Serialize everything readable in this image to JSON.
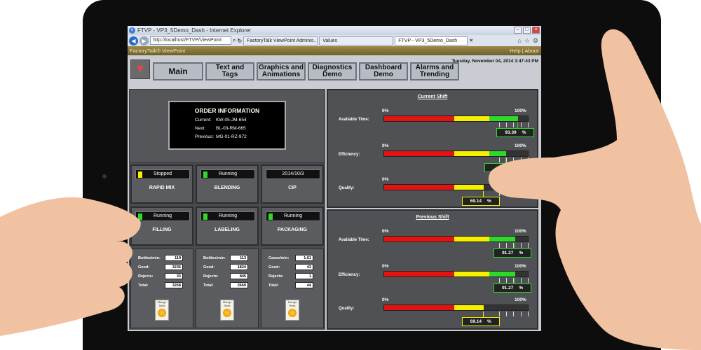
{
  "browser": {
    "window_title": "FTVP - VP3_5Demo_Dash - Internet Explorer",
    "url": "http://localhost/FTVP/ViewPoint",
    "tabs": [
      {
        "label": "FactoryTalk ViewPoint Adminis..."
      },
      {
        "label": "Values"
      },
      {
        "label": "FTVP - VP3_5Demo_Dash"
      }
    ]
  },
  "viewpoint_bar": {
    "brand": "FactoryTalk® ViewPoint",
    "help": "Help",
    "separator": "|",
    "about": "About"
  },
  "header": {
    "datetime": "Tuesday, November 04, 2014 3:47:43 PM",
    "nav": [
      {
        "line1": "Main",
        "line2": ""
      },
      {
        "line1": "Text and",
        "line2": "Tags"
      },
      {
        "line1": "Graphics and",
        "line2": "Animations"
      },
      {
        "line1": "Diagnostics",
        "line2": "Demo"
      },
      {
        "line1": "Dashboard",
        "line2": "Demo"
      },
      {
        "line1": "Alarms and",
        "line2": "Trending"
      }
    ]
  },
  "order": {
    "title": "ORDER INFORMATION",
    "current_label": "Current:",
    "current": "KW-05-JM-654",
    "next_label": "Next:",
    "next": "BL-03-RM-665",
    "previous_label": "Previous:",
    "previous": "MG-01-RZ-972"
  },
  "units": [
    {
      "name": "RAPID MIX",
      "status": "Stopped",
      "indicator_color": "#f4f000"
    },
    {
      "name": "BLENDING",
      "status": "Running",
      "indicator_color": "#2fd92b"
    },
    {
      "name": "CIP",
      "status": "2014/10/3",
      "indicator_color": ""
    },
    {
      "name": "FILLING",
      "status": "Running",
      "indicator_color": "#2fd92b"
    },
    {
      "name": "LABELING",
      "status": "Running",
      "indicator_color": "#2fd92b"
    },
    {
      "name": "PACKAGING",
      "status": "Running",
      "indicator_color": "#2fd92b"
    }
  ],
  "stats": [
    {
      "rate_label": "Bottles/min:",
      "rate": "119",
      "good_label": "Good:",
      "good": "3235",
      "rejects_label": "Rejects:",
      "rejects": "33",
      "total_label": "Total:",
      "total": "3268",
      "logo_text": "Mango Seek"
    },
    {
      "rate_label": "Bottles/min:",
      "rate": "113",
      "good_label": "Good:",
      "good": "1824",
      "rejects_label": "Rejects:",
      "rejects": "845",
      "total_label": "Total:",
      "total": "2669",
      "logo_text": "Mango Seek"
    },
    {
      "rate_label": "Cases/min:",
      "rate": "1.61",
      "good_label": "Good:",
      "good": "43",
      "rejects_label": "Rejects:",
      "rejects": "1",
      "total_label": "Total:",
      "total": "44",
      "logo_text": "Mango Seek"
    }
  ],
  "current_shift": {
    "title": "Current Shift",
    "gauges": [
      {
        "label": "Available Time:",
        "min": "0%",
        "max": "100%",
        "value": 93.39,
        "value_text": "93.39",
        "unit": "%",
        "color": "green"
      },
      {
        "label": "Efficiency:",
        "min": "0%",
        "max": "100%",
        "value": 85,
        "value_text": "",
        "unit": "",
        "color": "green"
      },
      {
        "label": "Quality:",
        "min": "0%",
        "max": "100%",
        "value": 69.14,
        "value_text": "69.14",
        "unit": "%",
        "color": "yellow"
      }
    ]
  },
  "previous_shift": {
    "title": "Previous Shift",
    "gauges": [
      {
        "label": "Available Time:",
        "min": "0%",
        "max": "100%",
        "value": 91.27,
        "value_text": "91.27",
        "unit": "%",
        "color": "green"
      },
      {
        "label": "Efficiency:",
        "min": "0%",
        "max": "100%",
        "value": 91.27,
        "value_text": "91.27",
        "unit": "%",
        "color": "green"
      },
      {
        "label": "Quality:",
        "min": "0%",
        "max": "100%",
        "value": 69.14,
        "value_text": "69.14",
        "unit": "%",
        "color": "yellow"
      }
    ]
  }
}
